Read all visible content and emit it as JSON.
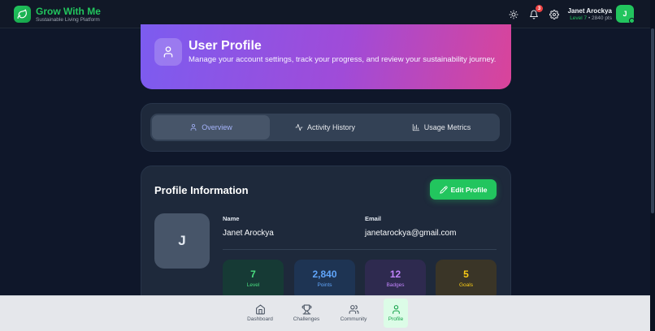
{
  "app": {
    "title": "Grow With Me",
    "subtitle": "Sustainable Living Platform"
  },
  "header": {
    "notification_count": "3",
    "user_name": "Janet Arockya",
    "user_level": "Level 7",
    "user_points": "• 2840 pts",
    "avatar_initial": "J"
  },
  "hero": {
    "title": "User Profile",
    "subtitle": "Manage your account settings, track your progress, and review your sustainability journey."
  },
  "tabs": [
    {
      "label": "Overview",
      "icon": "user-icon",
      "active": true
    },
    {
      "label": "Activity History",
      "icon": "activity-icon",
      "active": false
    },
    {
      "label": "Usage Metrics",
      "icon": "bar-chart-icon",
      "active": false
    }
  ],
  "profile": {
    "title": "Profile Information",
    "edit_label": "Edit Profile",
    "avatar_initial": "J",
    "name_label": "Name",
    "name_value": "Janet Arockya",
    "email_label": "Email",
    "email_value": "janetarockya@gmail.com"
  },
  "stats": [
    {
      "value": "7",
      "label": "Level",
      "color": "#4ade80",
      "bg": "#163a35"
    },
    {
      "value": "2,840",
      "label": "Points",
      "color": "#60a5fa",
      "bg": "#1e3453"
    },
    {
      "value": "12",
      "label": "Badges",
      "color": "#c084fc",
      "bg": "#2e2a4f"
    },
    {
      "value": "5",
      "label": "Goals",
      "color": "#facc15",
      "bg": "#3a3527"
    }
  ],
  "bottom_nav": [
    {
      "label": "Dashboard",
      "icon": "home-icon",
      "active": false
    },
    {
      "label": "Challenges",
      "icon": "trophy-icon",
      "active": false
    },
    {
      "label": "Community",
      "icon": "users-icon",
      "active": false
    },
    {
      "label": "Profile",
      "icon": "user-icon",
      "active": true
    }
  ],
  "colors": {
    "accent": "#22c55e",
    "background": "#0f172a",
    "card": "#1e293b",
    "tab_active_text": "#a5b4fc"
  }
}
